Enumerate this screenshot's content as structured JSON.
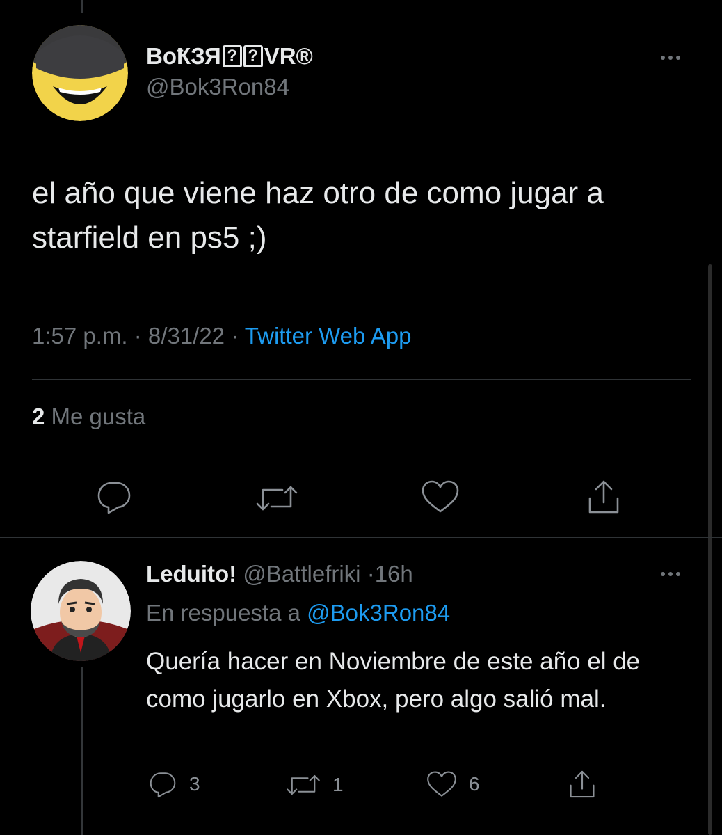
{
  "main_tweet": {
    "display_name_prefix": "BoҞЗЯ",
    "display_name_glyph_1": "?",
    "display_name_glyph_2": "?",
    "display_name_suffix": "VR®",
    "handle": "@Bok3Ron84",
    "text": "el año que viene haz otro de como jugar a starfield en ps5 ;)",
    "time": "1:57 p.m.",
    "separator": "·",
    "date": "8/31/22",
    "source": "Twitter Web App",
    "likes_count": "2",
    "likes_label": "Me gusta",
    "actions": [
      "reply-icon",
      "retweet-icon",
      "like-icon",
      "share-icon"
    ]
  },
  "reply_tweet": {
    "display_name": "Leduito!",
    "handle": "@Battlefriki",
    "separator": "·",
    "time_ago": "16h",
    "reply_prefix": "En respuesta a",
    "reply_mention": "@Bok3Ron84",
    "text": "Quería hacer en Noviembre de este año el de como jugarlo en Xbox, pero algo salió mal.",
    "replies": "3",
    "retweets": "1",
    "likes": "6"
  },
  "colors": {
    "background": "#000000",
    "text": "#e7e9ea",
    "secondary": "#71767b",
    "accent": "#1d9bf0",
    "divider": "#2f3336"
  }
}
